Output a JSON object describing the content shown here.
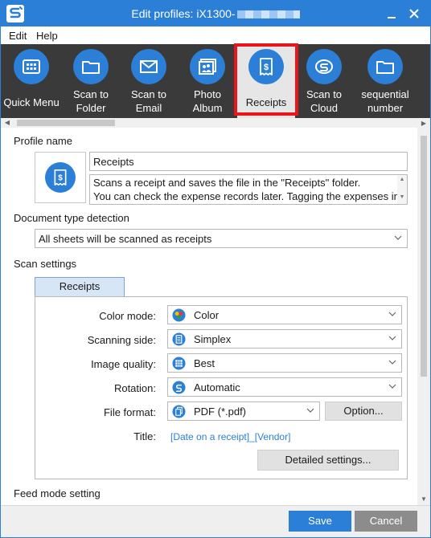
{
  "window": {
    "title": "Edit profiles: iX1300-",
    "minimize_icon": "minimize-icon",
    "close_icon": "close-icon",
    "accent_color": "#2b7fd6"
  },
  "menu": [
    {
      "label": "Edit"
    },
    {
      "label": "Help"
    }
  ],
  "toolbar": {
    "selected": "Receipts",
    "highlight_color": "#e8151b",
    "items": [
      {
        "label": "Quick Menu",
        "icon": "grid-icon"
      },
      {
        "label": "Scan to Folder",
        "icon": "folder-icon"
      },
      {
        "label": "Scan to Email",
        "icon": "envelope-icon"
      },
      {
        "label": "Photo Album",
        "icon": "photo-icon"
      },
      {
        "label": "Receipts",
        "icon": "receipt-icon"
      },
      {
        "label": "Scan to Cloud",
        "icon": "cloud-icon"
      },
      {
        "label": "sequential number",
        "icon": "folder-icon"
      }
    ]
  },
  "profile": {
    "section_label": "Profile name",
    "name": "Receipts",
    "icon": "receipt-icon",
    "description_lines": [
      "Scans a receipt and saves the file in the \"Receipts\" folder.",
      "You can check the expense records later. Tagging the expenses in"
    ]
  },
  "document_type": {
    "section_label": "Document type detection",
    "selected": "All sheets will be scanned as receipts"
  },
  "scan_settings": {
    "section_label": "Scan settings",
    "tab_label": "Receipts",
    "color_mode": {
      "label": "Color mode:",
      "value": "Color",
      "icon": "color-palette-icon"
    },
    "scanning_side": {
      "label": "Scanning side:",
      "value": "Simplex",
      "icon": "simplex-page-icon"
    },
    "image_quality": {
      "label": "Image quality:",
      "value": "Best",
      "icon": "quality-grid-icon"
    },
    "rotation": {
      "label": "Rotation:",
      "value": "Automatic",
      "icon": "rotation-icon"
    },
    "file_format": {
      "label": "File format:",
      "value": "PDF (*.pdf)",
      "icon": "pdf-pages-icon",
      "option_label": "Option..."
    },
    "title": {
      "label": "Title:",
      "value": "[Date on a receipt]_[Vendor]"
    },
    "detailed_settings_label": "Detailed settings..."
  },
  "feed_mode": {
    "section_label": "Feed mode setting"
  },
  "footer": {
    "save_label": "Save",
    "cancel_label": "Cancel"
  }
}
